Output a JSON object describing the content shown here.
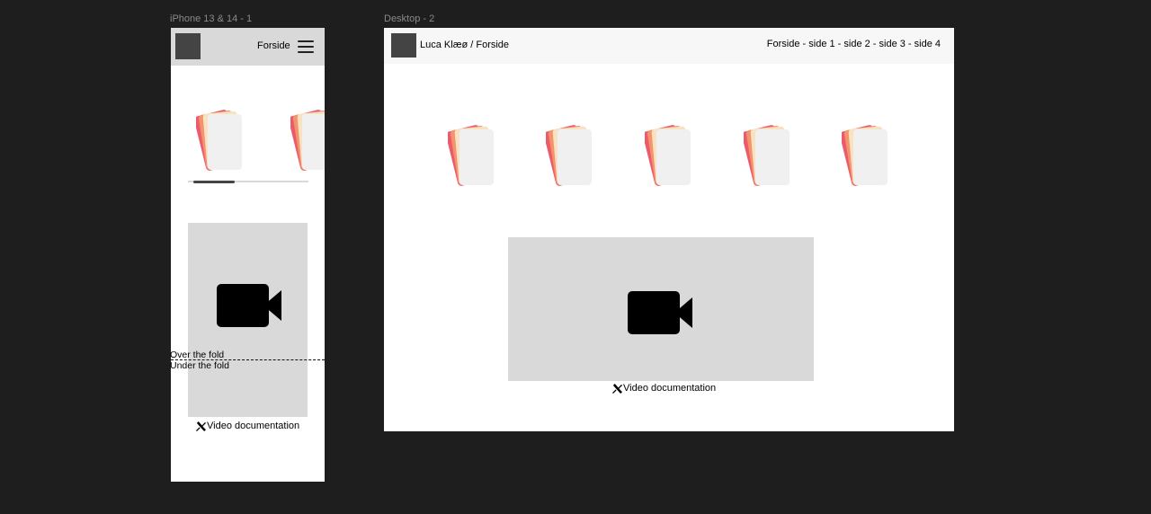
{
  "frames": {
    "mobile_label": "iPhone 13 & 14 - 1",
    "desktop_label": "Desktop - 2"
  },
  "mobile": {
    "header_title": "Forside",
    "caption": "Video documentation"
  },
  "fold": {
    "over": "Over the fold",
    "under": "Under the fold"
  },
  "desktop": {
    "breadcrumb": "Luca Klæø / Forside",
    "nav": "Forside - side 1 - side 2 - side 3 - side 4",
    "caption": "Video documentation"
  },
  "icons": {
    "menu": "hamburger-menu-icon",
    "video": "video-camera-icon",
    "tools": "tools-icon",
    "cards": "card-stack-icon"
  },
  "colors": {
    "canvas": "#1e1e1e",
    "placeholder": "#d9d9d9",
    "logo": "#444444",
    "card_red": "#ea5b6b",
    "card_orange": "#f5936d",
    "card_cream": "#f7e3c4",
    "card_light": "#f0f0f0"
  }
}
